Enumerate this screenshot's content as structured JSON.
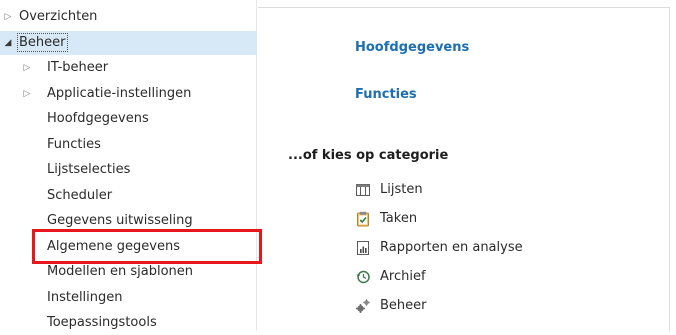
{
  "nav": {
    "items": [
      {
        "label": "Overzichten",
        "arrow": "▷"
      },
      {
        "label": "Beheer",
        "arrow": "◢"
      },
      {
        "label": "IT-beheer",
        "arrow": "▷"
      },
      {
        "label": "Applicatie-instellingen",
        "arrow": "▷"
      },
      {
        "label": "Hoofdgegevens"
      },
      {
        "label": "Functies"
      },
      {
        "label": "Lijstselecties"
      },
      {
        "label": "Scheduler"
      },
      {
        "label": "Gegevens uitwisseling"
      },
      {
        "label": "Algemene gegevens"
      },
      {
        "label": "Modellen en sjablonen"
      },
      {
        "label": "Instellingen"
      },
      {
        "label": "Toepassingstools"
      }
    ]
  },
  "content": {
    "links": {
      "hoofdgegevens": "Hoofdgegevens",
      "functies": "Functies"
    },
    "category_heading": "...of kies op categorie",
    "categories": [
      {
        "label": "Lijsten",
        "icon": "list-grid-icon"
      },
      {
        "label": "Taken",
        "icon": "clipboard-check-icon"
      },
      {
        "label": "Rapporten en analyse",
        "icon": "report-chart-icon"
      },
      {
        "label": "Archief",
        "icon": "history-clock-icon"
      },
      {
        "label": "Beheer",
        "icon": "gears-icon"
      }
    ]
  },
  "colors": {
    "selection": "#d7e8f7",
    "link": "#1c6fb3",
    "highlight": "#e8171e"
  }
}
